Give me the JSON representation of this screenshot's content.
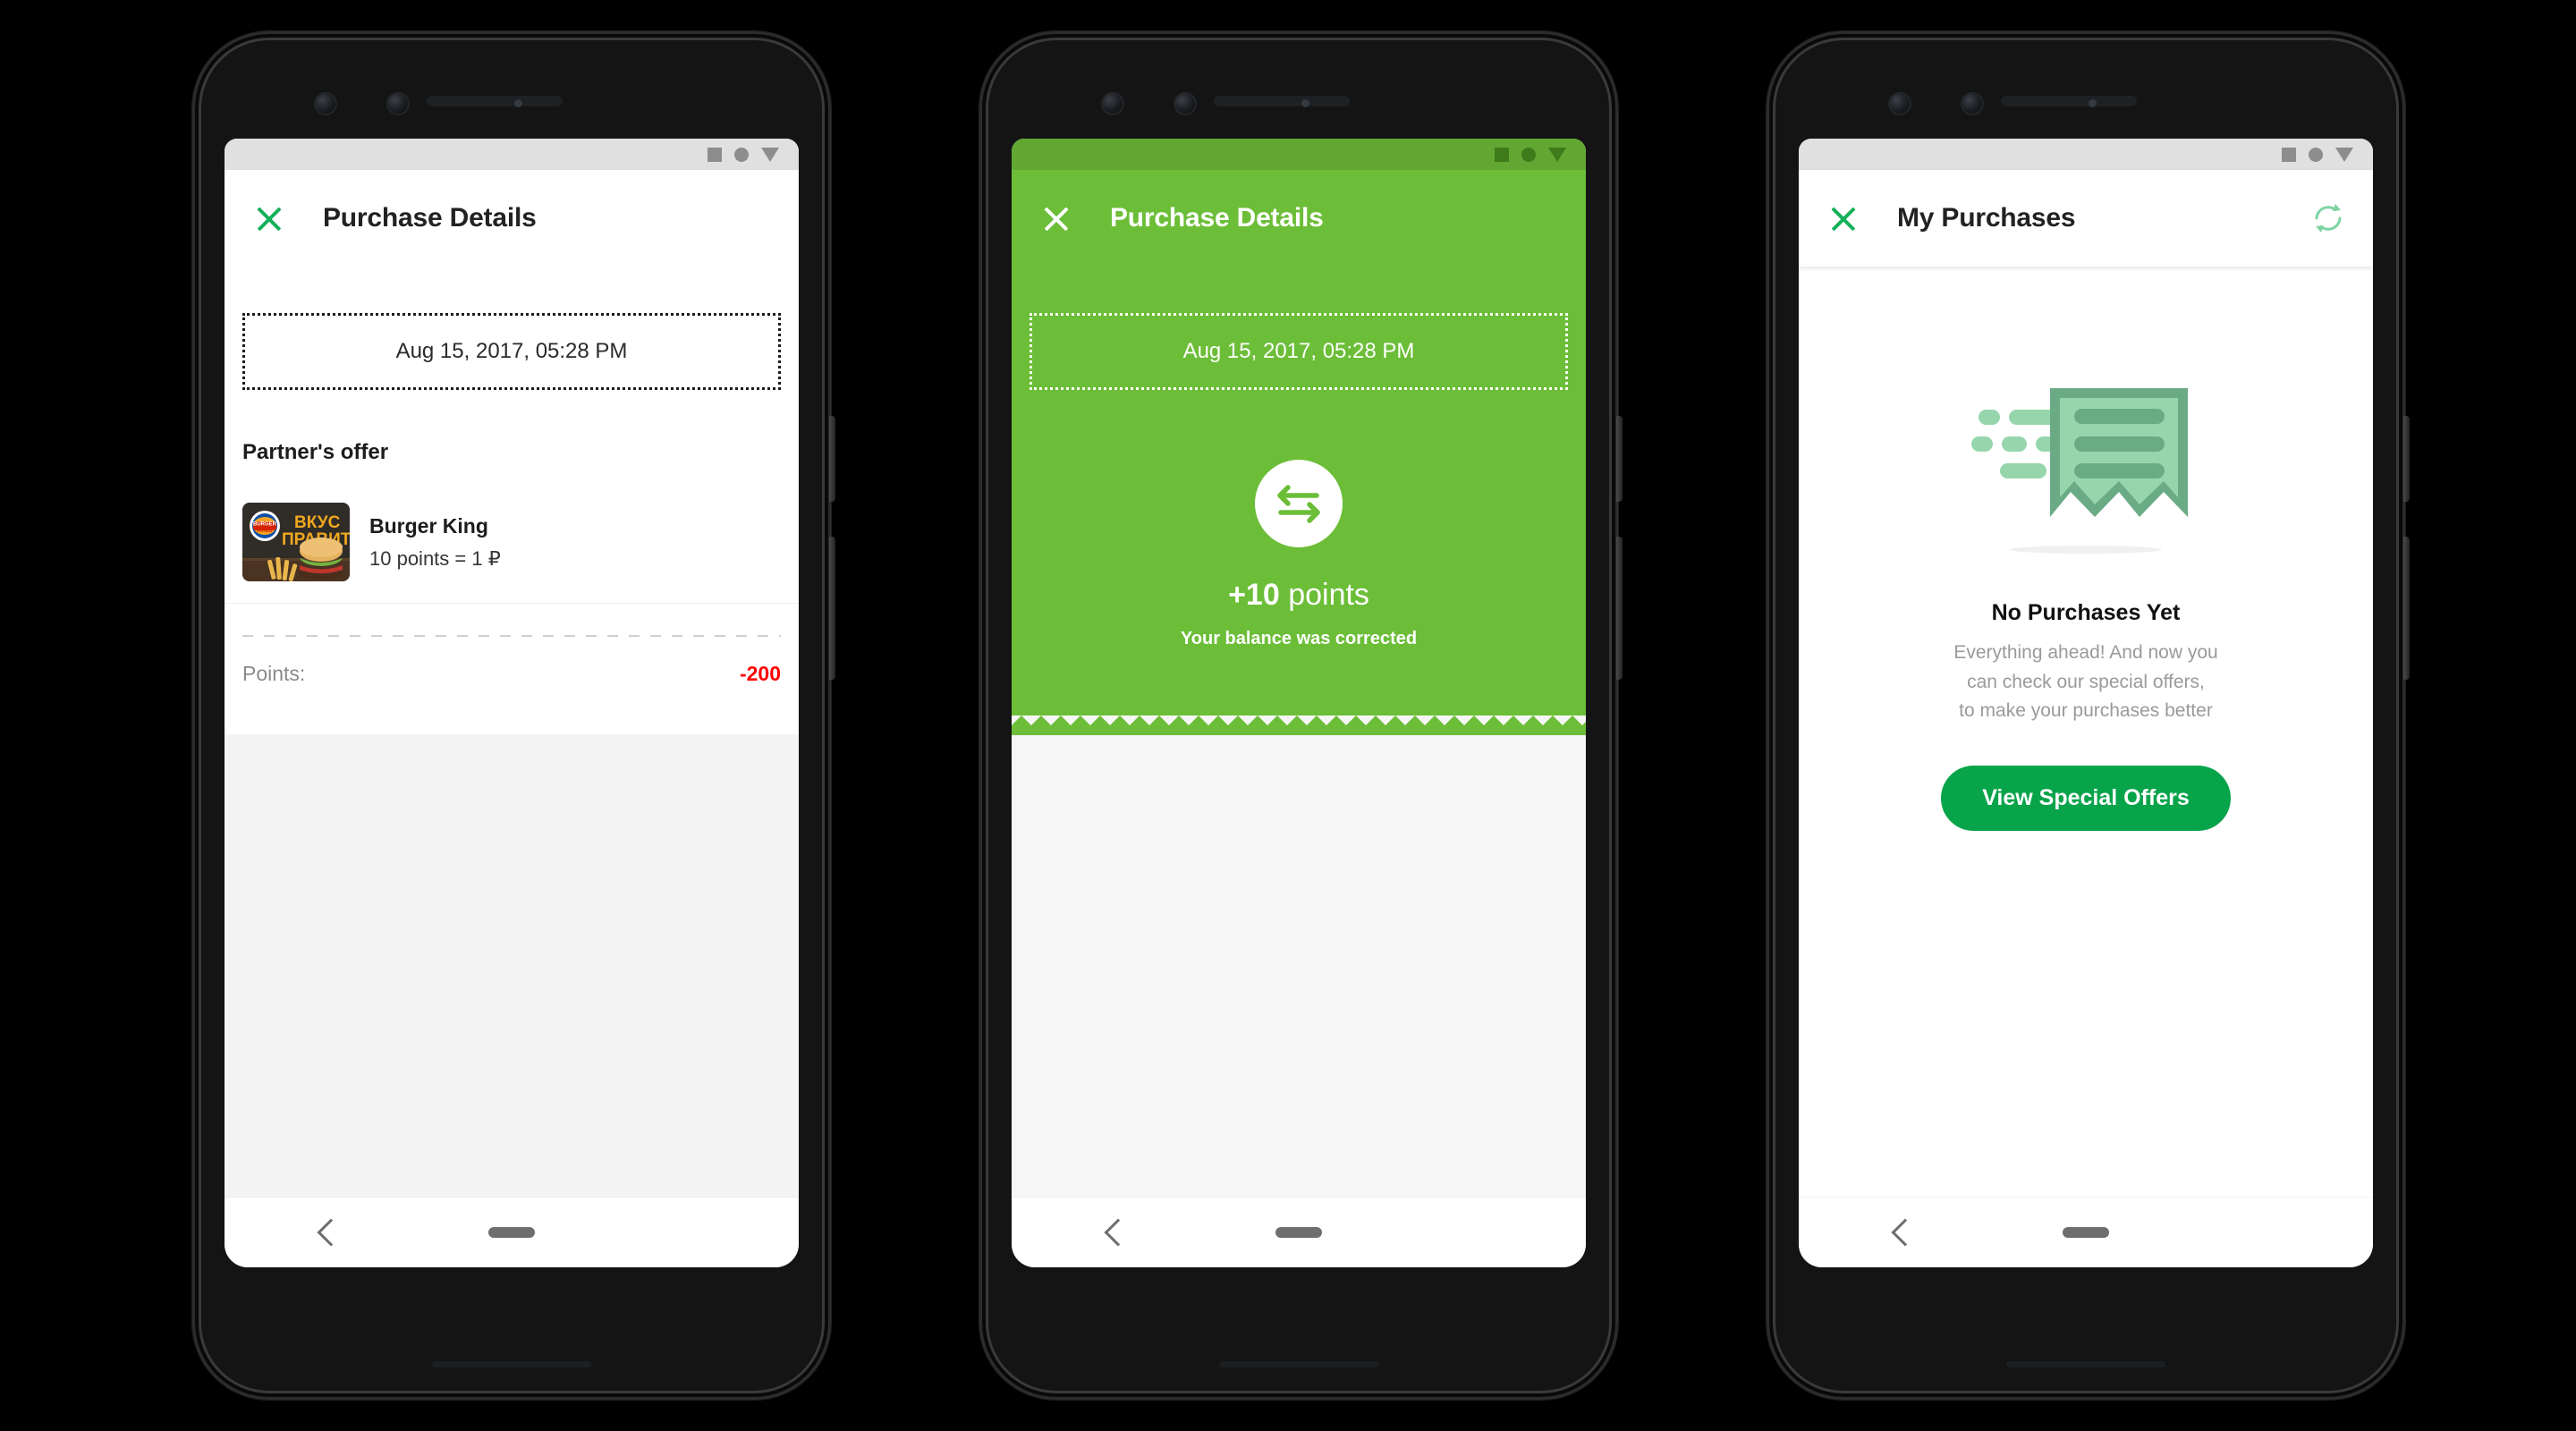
{
  "theme": {
    "brand_green": "#07a44a",
    "panel_green": "#6cbe38",
    "status_green_dark": "#62a732",
    "close_icon_green": "#14b05a",
    "negative_red": "#ff0000",
    "muted_gray": "#9a9a9a",
    "illustration_green_dark": "#6aab85",
    "illustration_green_light": "#97d6ad"
  },
  "phones": [
    {
      "id": "phone-purchase-details-light",
      "statusbar": {
        "icons": [
          "square-icon",
          "circle-icon",
          "triangle-down-icon"
        ]
      },
      "appbar": {
        "close_icon": "close-icon",
        "title": "Purchase Details",
        "refresh_icon": null
      },
      "receipt": {
        "date": "Aug 15, 2017, 05:28 PM",
        "section_title": "Partner's offer",
        "offer": {
          "name": "Burger King",
          "rate": "10 points = 1 ₽",
          "thumb_alt": "burger-king-promo-image",
          "thumb_text_line1": "ВКУС",
          "thumb_text_line2": "ПРАВИТ",
          "logo_line1": "BURGER",
          "logo_line2": "KING"
        },
        "points_label": "Points:",
        "points_value": "-200"
      },
      "navbar": {
        "back_icon": "chevron-left-icon",
        "home_icon": "home-pill-icon"
      }
    },
    {
      "id": "phone-purchase-details-green",
      "statusbar": {
        "icons": [
          "square-icon",
          "circle-icon",
          "triangle-down-icon"
        ]
      },
      "appbar": {
        "close_icon": "close-icon",
        "title": "Purchase Details",
        "refresh_icon": null
      },
      "receipt": {
        "date": "Aug 15, 2017, 05:28 PM",
        "badge_icon": "exchange-arrows-icon",
        "points_amount": "+10",
        "points_unit": "points",
        "balance_note": "Your balance was corrected"
      },
      "navbar": {
        "back_icon": "chevron-left-icon",
        "home_icon": "home-pill-icon"
      }
    },
    {
      "id": "phone-my-purchases-empty",
      "statusbar": {
        "icons": [
          "square-icon",
          "circle-icon",
          "triangle-down-icon"
        ]
      },
      "appbar": {
        "close_icon": "close-icon",
        "title": "My Purchases",
        "refresh_icon": "refresh-icon"
      },
      "empty_state": {
        "illustration": "receipt-with-motion-lines-icon",
        "title": "No Purchases Yet",
        "subtitle_line1": "Everything ahead! And now you",
        "subtitle_line2": "can check our special offers,",
        "subtitle_line3": "to make your purchases better",
        "cta_label": "View Special Offers"
      },
      "navbar": {
        "back_icon": "chevron-left-icon",
        "home_icon": "home-pill-icon"
      }
    }
  ]
}
